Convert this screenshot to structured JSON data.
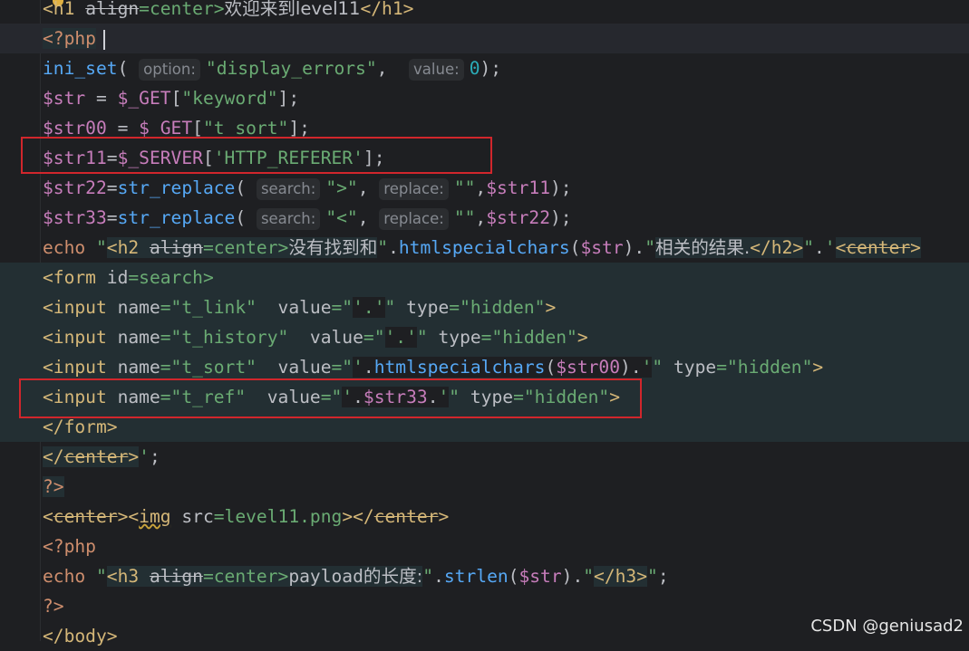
{
  "watermark": "CSDN @geniusad2",
  "hints": {
    "option": "option:",
    "value": "value:",
    "search": "search:",
    "replace": "replace:"
  },
  "code": {
    "l0": {
      "open": "<",
      "tag": "h1",
      "attr": "align",
      "eq": "=center>",
      "text": "欢迎来到level11",
      "close": "</h1>"
    },
    "l1": {
      "php": "<?php"
    },
    "l2": {
      "fn": "ini_set",
      "p1": "(",
      "s1": "\"display_errors\"",
      "comma": ",",
      "num": "0",
      "end": ");"
    },
    "l3": {
      "var": "$str",
      "op": " = ",
      "g": "$_GET",
      "b1": "[",
      "s": "\"keyword\"",
      "b2": "];"
    },
    "l4": {
      "var": "$str00",
      "op": " = ",
      "g": "$_GET",
      "b1": "[",
      "s": "\"t_sort\"",
      "b2": "];"
    },
    "l5": {
      "var": "$str11",
      "op": "=",
      "g": "$_SERVER",
      "b1": "[",
      "s": "'HTTP_REFERER'",
      "b2": "];"
    },
    "l6": {
      "var": "$str22",
      "op": "=",
      "fn": "str_replace",
      "p": "(",
      "s1": "\">\"",
      "c1": ",",
      "s2": "\"\"",
      "c2": ",",
      "v2": "$str11",
      "end": ");"
    },
    "l7": {
      "var": "$str33",
      "op": "=",
      "fn": "str_replace",
      "p": "(",
      "s1": "\"<\"",
      "c1": ",",
      "s2": "\"\"",
      "c2": ",",
      "v2": "$str22",
      "end": ");"
    },
    "l8": {
      "echo": "echo",
      "q": " \"",
      "t1": "<h2 ",
      "attr": "align",
      "t2": "=center>",
      "cn": "没有找到和",
      "q2": "\"",
      "dot": ".",
      "fn": "htmlspecialchars",
      "p": "(",
      "v": "$str",
      "p2": ")",
      "dot2": ".",
      "q3": "\"",
      "cn2": "相关的结果.",
      "t3": "</h2>",
      "q4": "\"",
      "dot3": ".",
      "q5": "'",
      "t4": "<",
      "c": "center",
      "t5": ">"
    },
    "l9": {
      "t": "<form ",
      "a": "id",
      "eq": "=search>"
    },
    "l10": {
      "t": "<input ",
      "a1": "name",
      "v1": "=\"t_link\"",
      "sp": "  ",
      "a2": "value",
      "v2a": "=\"",
      "q": "'.'",
      "v2b": "\"",
      "a3": " type",
      "v3": "=\"hidden\"",
      "end": ">"
    },
    "l11": {
      "t": "<input ",
      "a1": "name",
      "v1": "=\"t_history\"",
      "sp": "  ",
      "a2": "value",
      "v2a": "=\"",
      "q": "'.'",
      "v2b": "\"",
      "a3": " type",
      "v3": "=\"hidden\"",
      "end": ">"
    },
    "l12": {
      "t": "<input ",
      "a1": "name",
      "v1": "=\"t_sort\"",
      "sp": "  ",
      "a2": "value",
      "v2a": "=\"",
      "q": "'",
      "dot": ".",
      "fn": "htmlspecialchars",
      "p": "(",
      "v": "$str00",
      "p2": ")",
      "dot2": ".",
      "q2": "'",
      "v2b": "\"",
      "a3": " type",
      "v3": "=\"hidden\"",
      "end": ">"
    },
    "l13": {
      "t": "<input ",
      "a1": "name",
      "v1": "=\"t_ref\"",
      "sp": "  ",
      "a2": "value",
      "v2a": "=\"",
      "q": "'",
      "dot": ".",
      "v": "$str33",
      "dot2": ".",
      "q2": "'",
      "v2b": "\"",
      "a3": " type",
      "v3": "=\"hidden\"",
      "end": ">"
    },
    "l14": {
      "t": "</form>"
    },
    "l15": {
      "t1": "</",
      "c": "center",
      "t2": ">",
      "q": "'",
      "semi": ";"
    },
    "l16": {
      "php": "?>"
    },
    "l17": {
      "t1": "<",
      "c": "center",
      "t2": "><",
      "img": "img",
      "a": " src",
      "v": "=level11.png",
      "t3": "></",
      "c2": "center",
      "t4": ">"
    },
    "l18": {
      "php": "<?php"
    },
    "l19": {
      "echo": "echo",
      "q": " \"",
      "t1": "<h3 ",
      "attr": "align",
      "t2": "=center>",
      "txt": "payload",
      "cn": "的长度:",
      "q2": "\"",
      "dot": ".",
      "fn": "strlen",
      "p": "(",
      "v": "$str",
      "p2": ")",
      "dot2": ".",
      "q3": "\"",
      "t3": "</h3>",
      "q4": "\"",
      "semi": ";"
    },
    "l20": {
      "php": "?>"
    },
    "l21": {
      "t": "</body>"
    }
  }
}
